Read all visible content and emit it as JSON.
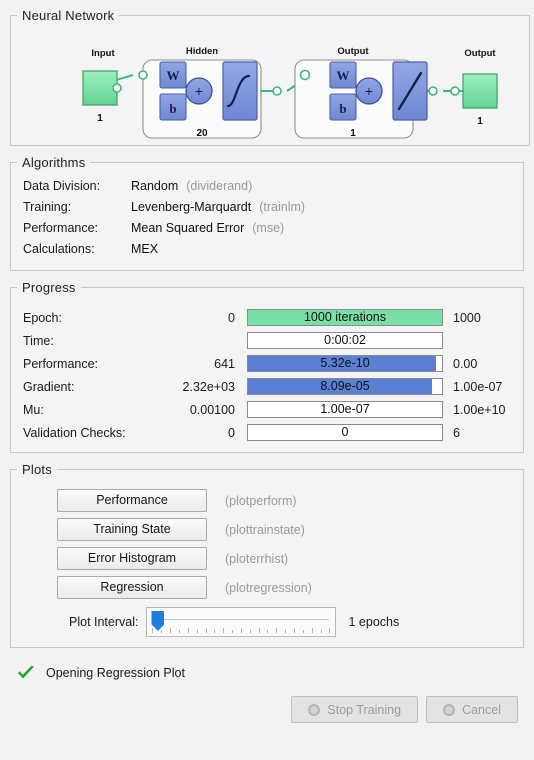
{
  "neural_network": {
    "title": "Neural Network",
    "input_label": "Input",
    "input_size": "1",
    "hidden_label": "Hidden",
    "hidden_size": "20",
    "output_layer_label": "Output",
    "output_layer_size": "1",
    "output_label": "Output",
    "output_size": "1",
    "weight_symbol": "W",
    "bias_symbol": "b",
    "sum_symbol": "+",
    "colors": {
      "io_block": "#7fe0a5",
      "layer_block": "#7f96dd",
      "link": "#3cb878"
    }
  },
  "algorithms": {
    "title": "Algorithms",
    "rows": [
      {
        "label": "Data Division:",
        "value": "Random",
        "func": "(dividerand)"
      },
      {
        "label": "Training:",
        "value": "Levenberg-Marquardt",
        "func": "(trainlm)"
      },
      {
        "label": "Performance:",
        "value": "Mean Squared Error",
        "func": "(mse)"
      },
      {
        "label": "Calculations:",
        "value": "MEX",
        "func": ""
      }
    ]
  },
  "progress": {
    "title": "Progress",
    "rows": [
      {
        "label": "Epoch:",
        "min": "0",
        "value": "1000 iterations",
        "max": "1000",
        "fill_pct": 100,
        "fill_color": "green"
      },
      {
        "label": "Time:",
        "min": "",
        "value": "0:00:02",
        "max": "",
        "fill_pct": 0,
        "fill_color": "none"
      },
      {
        "label": "Performance:",
        "min": "641",
        "value": "5.32e-10",
        "max": "0.00",
        "fill_pct": 97,
        "fill_color": "blue"
      },
      {
        "label": "Gradient:",
        "min": "2.32e+03",
        "value": "8.09e-05",
        "max": "1.00e-07",
        "fill_pct": 95,
        "fill_color": "blue"
      },
      {
        "label": "Mu:",
        "min": "0.00100",
        "value": "1.00e-07",
        "max": "1.00e+10",
        "fill_pct": 0,
        "fill_color": "none"
      },
      {
        "label": "Validation Checks:",
        "min": "0",
        "value": "0",
        "max": "6",
        "fill_pct": 0,
        "fill_color": "none"
      }
    ]
  },
  "plots": {
    "title": "Plots",
    "buttons": [
      {
        "label": "Performance",
        "func": "(plotperform)"
      },
      {
        "label": "Training State",
        "func": "(plottrainstate)"
      },
      {
        "label": "Error Histogram",
        "func": "(ploterrhist)"
      },
      {
        "label": "Regression",
        "func": "(plotregression)"
      }
    ],
    "interval_label": "Plot Interval:",
    "interval_value": "1 epochs"
  },
  "status": {
    "icon": "check-icon",
    "text": "Opening Regression Plot",
    "icon_color": "#22a52a"
  },
  "footer": {
    "stop_label": "Stop Training",
    "cancel_label": "Cancel"
  }
}
